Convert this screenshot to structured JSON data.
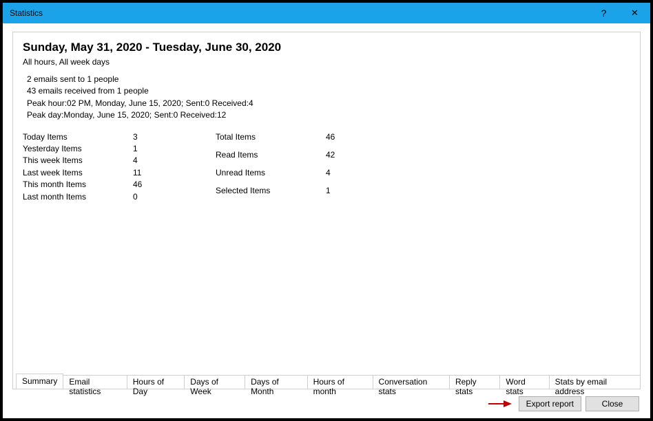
{
  "window": {
    "title": "Statistics",
    "help_glyph": "?",
    "close_glyph": "✕"
  },
  "header": {
    "range": "Sunday, May 31, 2020 - Tuesday, June 30, 2020",
    "filter": "All hours, All week days"
  },
  "info_lines": {
    "l1": "2 emails sent to 1 people",
    "l2": "43 emails received from 1 people",
    "l3": "Peak hour:02 PM, Monday, June 15, 2020; Sent:0 Received:4",
    "l4": "Peak day:Monday, June 15, 2020; Sent:0 Received:12"
  },
  "stats_left": {
    "r0": {
      "label": "Today Items",
      "value": "3"
    },
    "r1": {
      "label": "Yesterday Items",
      "value": "1"
    },
    "r2": {
      "label": "This week Items",
      "value": "4"
    },
    "r3": {
      "label": "Last week Items",
      "value": "11"
    },
    "r4": {
      "label": "This month Items",
      "value": "46"
    },
    "r5": {
      "label": "Last month Items",
      "value": "0"
    }
  },
  "stats_right": {
    "r0": {
      "label": "Total Items",
      "value": "46"
    },
    "r1": {
      "label": "Read Items",
      "value": "42"
    },
    "r2": {
      "label": "Unread Items",
      "value": "4"
    },
    "r3": {
      "label": "Selected Items",
      "value": "1"
    }
  },
  "tabs": {
    "t0": "Summary",
    "t1": "Email statistics",
    "t2": "Hours of Day",
    "t3": "Days of Week",
    "t4": "Days of Month",
    "t5": "Hours of month",
    "t6": "Conversation stats",
    "t7": "Reply stats",
    "t8": "Word stats",
    "t9": "Stats by email address"
  },
  "buttons": {
    "export": "Export report",
    "close": "Close"
  },
  "colors": {
    "titlebar": "#1aa3e8",
    "arrow": "#c00000"
  }
}
